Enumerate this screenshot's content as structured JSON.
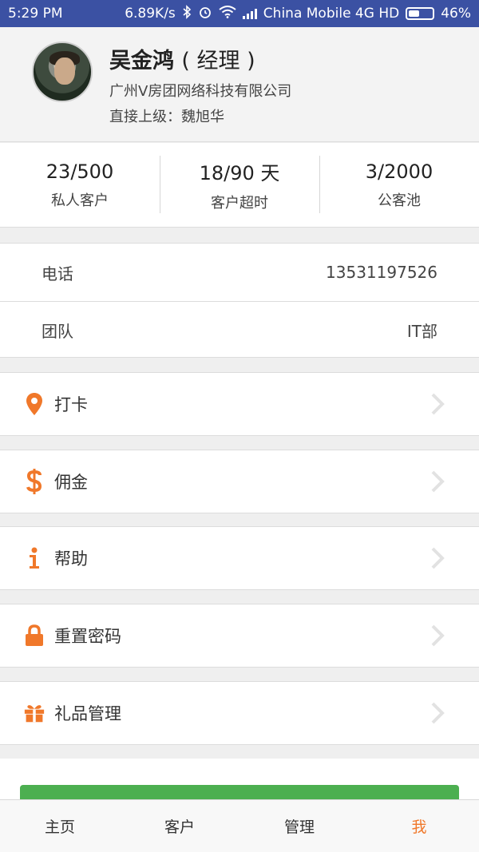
{
  "status_bar": {
    "time": "5:29 PM",
    "speed": "6.89K/s",
    "carrier": "China Mobile 4G HD",
    "battery_text": "46%",
    "battery_level": 0.46
  },
  "profile": {
    "name": "吴金鸿",
    "role": "( 经理 )",
    "company": "广州V房团网络科技有限公司",
    "superior": "直接上级：魏旭华"
  },
  "stats": [
    {
      "value": "23/500",
      "label": "私人客户"
    },
    {
      "value": "18/90 天",
      "label": "客户超时"
    },
    {
      "value": "3/2000",
      "label": "公客池"
    }
  ],
  "info": {
    "phone_label": "电话",
    "phone_value": "13531197526",
    "team_label": "团队",
    "team_value": "IT部"
  },
  "menu": [
    {
      "label": "打卡",
      "icon": "location-pin-icon"
    },
    {
      "label": "佣金",
      "icon": "dollar-icon"
    },
    {
      "label": "帮助",
      "icon": "info-icon"
    },
    {
      "label": "重置密码",
      "icon": "lock-icon"
    },
    {
      "label": "礼品管理",
      "icon": "gift-icon"
    }
  ],
  "tabs": [
    {
      "label": "主页",
      "active": false
    },
    {
      "label": "客户",
      "active": false
    },
    {
      "label": "管理",
      "active": false
    },
    {
      "label": "我",
      "active": true
    }
  ],
  "colors": {
    "status_bar": "#3b51a3",
    "accent": "#f0782a",
    "button_green": "#4caf50"
  }
}
